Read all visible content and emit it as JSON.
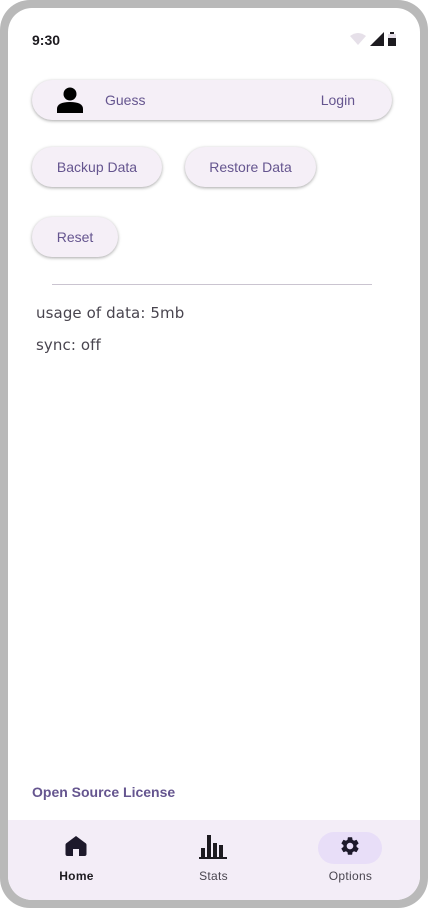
{
  "status_bar": {
    "time": "9:30",
    "icons": [
      "wifi-icon",
      "signal-icon",
      "battery-icon"
    ]
  },
  "user": {
    "name": "Guess",
    "login_label": "Login",
    "icon": "person-icon"
  },
  "actions": {
    "backup_label": "Backup Data",
    "restore_label": "Restore Data",
    "reset_label": "Reset"
  },
  "info": {
    "usage": "usage of data: 5mb",
    "sync": "sync: off"
  },
  "footer": {
    "license_label": "Open Source License"
  },
  "nav": {
    "items": [
      {
        "label": "Home",
        "icon": "home-icon",
        "selected": false
      },
      {
        "label": "Stats",
        "icon": "bar-chart-icon",
        "selected": false
      },
      {
        "label": "Options",
        "icon": "gear-icon",
        "selected": true
      }
    ]
  },
  "colors": {
    "accent_text": "#65558f",
    "surface": "#f5eff7",
    "nav_background": "#f3edf7",
    "active_indicator": "#e8def8",
    "frame": "#b9b9b9"
  }
}
